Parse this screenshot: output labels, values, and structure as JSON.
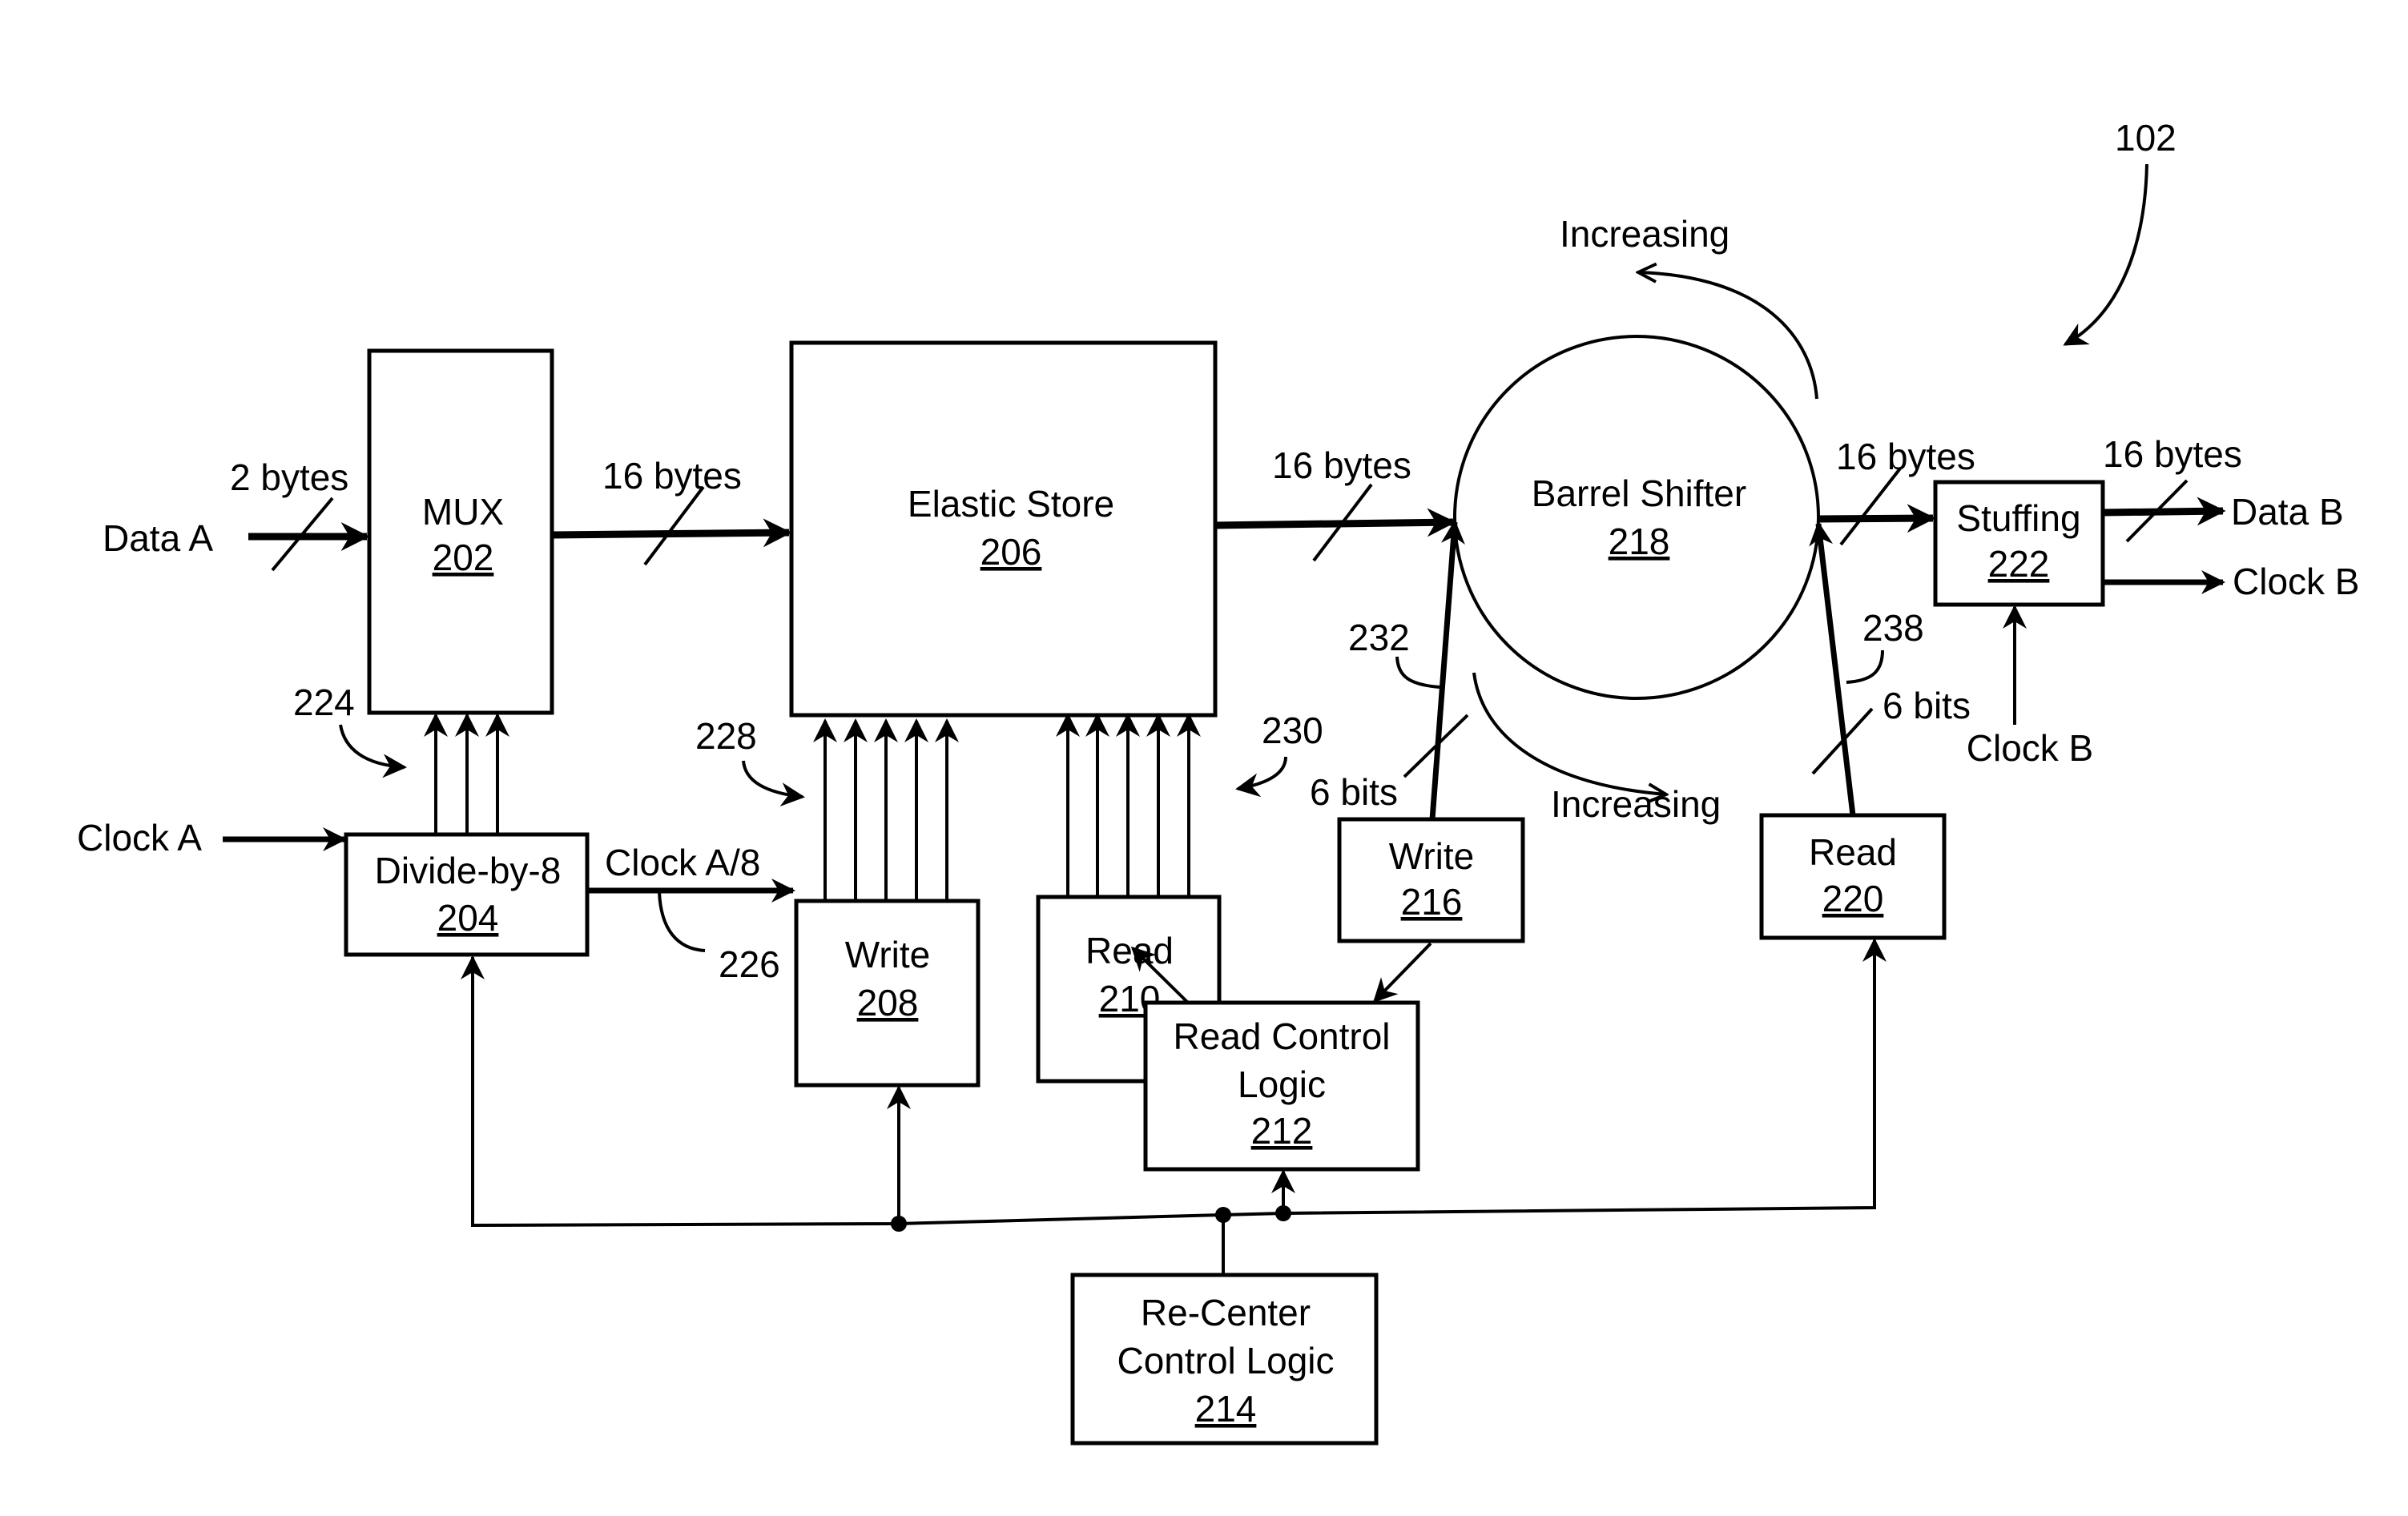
{
  "figure_ref": "102",
  "blocks": {
    "mux": {
      "name": "MUX",
      "ref": "202"
    },
    "divider": {
      "name": "Divide-by-8",
      "ref": "204"
    },
    "elastic_store": {
      "name": "Elastic Store",
      "ref": "206"
    },
    "write_es": {
      "name": "Write",
      "ref": "208"
    },
    "read_es": {
      "name": "Read",
      "ref": "210"
    },
    "read_control": {
      "line1": "Read Control",
      "line2": "Logic",
      "ref": "212"
    },
    "recenter": {
      "line1": "Re-Center",
      "line2": "Control Logic",
      "ref": "214"
    },
    "write_bs": {
      "name": "Write",
      "ref": "216"
    },
    "barrel_shifter": {
      "name": "Barrel Shifter",
      "ref": "218"
    },
    "read_bs": {
      "name": "Read",
      "ref": "220"
    },
    "stuffing": {
      "name": "Stuffing",
      "ref": "222"
    }
  },
  "signals": {
    "data_a": "Data A",
    "clock_a": "Clock A",
    "clock_a8": "Clock A/8",
    "data_b": "Data B",
    "clock_b_out": "Clock B",
    "clock_b_in": "Clock B"
  },
  "widths": {
    "data_a_in": "2 bytes",
    "mux_to_es": "16 bytes",
    "es_to_bs": "16 bytes",
    "bs_to_stuff": "16 bytes",
    "stuff_out": "16 bytes",
    "write_bits": "6 bits",
    "read_bits": "6 bits"
  },
  "refs": {
    "r224": "224",
    "r226": "226",
    "r228": "228",
    "r230": "230",
    "r232": "232",
    "r238": "238"
  },
  "directions": {
    "top": "Increasing",
    "bottom": "Increasing"
  }
}
